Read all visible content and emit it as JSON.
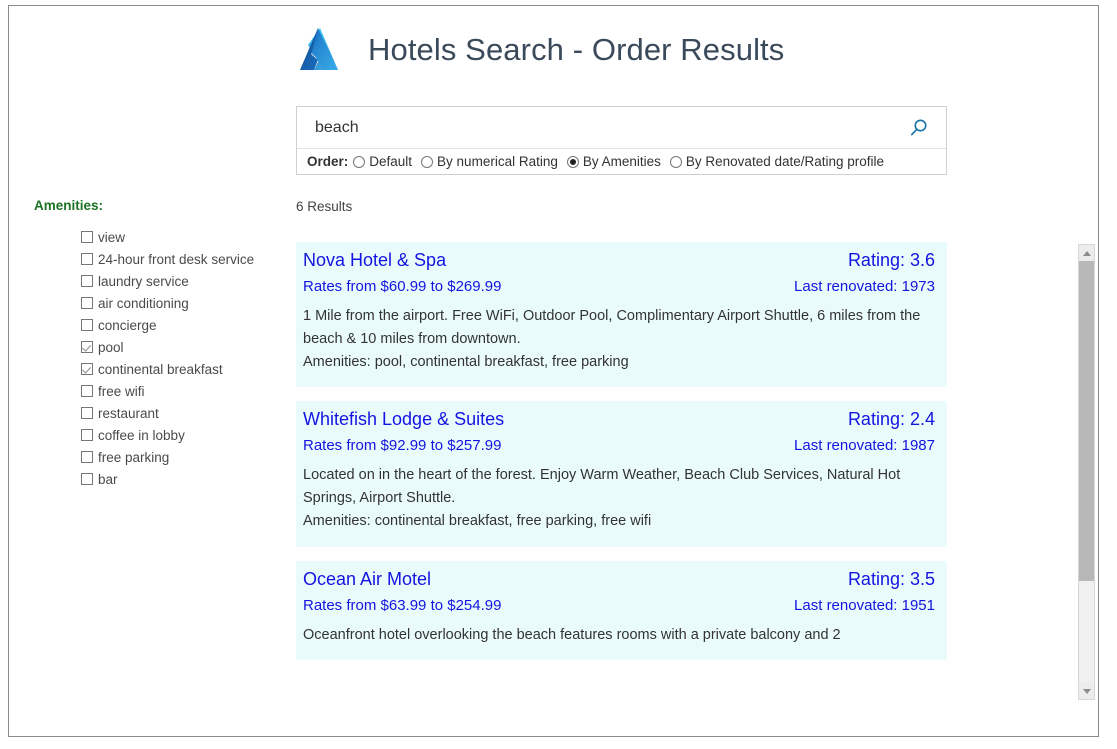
{
  "header": {
    "title": "Hotels Search - Order Results",
    "logo_icon": "azure-logo-icon"
  },
  "search": {
    "value": "beach",
    "placeholder": "",
    "search_icon": "search-icon",
    "order_label": "Order:",
    "order_options": [
      {
        "label": "Default",
        "selected": false
      },
      {
        "label": "By numerical Rating",
        "selected": false
      },
      {
        "label": "By Amenities",
        "selected": true
      },
      {
        "label": "By Renovated date/Rating profile",
        "selected": false
      }
    ]
  },
  "sidebar": {
    "title": "Amenities:",
    "title_color": "#1d7324",
    "items": [
      {
        "label": "view",
        "checked": false
      },
      {
        "label": "24-hour front desk service",
        "checked": false
      },
      {
        "label": "laundry service",
        "checked": false
      },
      {
        "label": "air conditioning",
        "checked": false
      },
      {
        "label": "concierge",
        "checked": false
      },
      {
        "label": "pool",
        "checked": true
      },
      {
        "label": "continental breakfast",
        "checked": true
      },
      {
        "label": "free wifi",
        "checked": false
      },
      {
        "label": "restaurant",
        "checked": false
      },
      {
        "label": "coffee in lobby",
        "checked": false
      },
      {
        "label": "free parking",
        "checked": false
      },
      {
        "label": "bar",
        "checked": false
      }
    ]
  },
  "results": {
    "count_label": "6 Results",
    "link_color": "#1414e0",
    "card_background": "#eafbfc",
    "items": [
      {
        "name": "Nova Hotel & Spa",
        "rating": "Rating: 3.6",
        "rates": "Rates from $60.99 to $269.99",
        "renovated": "Last renovated: 1973",
        "description": "1 Mile from the airport.  Free WiFi, Outdoor Pool, Complimentary Airport Shuttle, 6 miles from the beach & 10 miles from downtown.",
        "amenities": "Amenities: pool, continental breakfast, free parking"
      },
      {
        "name": "Whitefish Lodge & Suites",
        "rating": "Rating: 2.4",
        "rates": "Rates from $92.99 to $257.99",
        "renovated": "Last renovated: 1987",
        "description": "Located on in the heart of the forest. Enjoy Warm Weather, Beach Club Services, Natural Hot Springs, Airport Shuttle.",
        "amenities": "Amenities: continental breakfast, free parking, free wifi"
      },
      {
        "name": "Ocean Air Motel",
        "rating": "Rating: 3.5",
        "rates": "Rates from $63.99 to $254.99",
        "renovated": "Last renovated: 1951",
        "description": "Oceanfront hotel overlooking the beach features rooms with a private balcony and 2",
        "amenities": ""
      }
    ]
  },
  "scrollbar": {
    "up_icon": "chevron-up-icon",
    "down_icon": "chevron-down-icon"
  }
}
